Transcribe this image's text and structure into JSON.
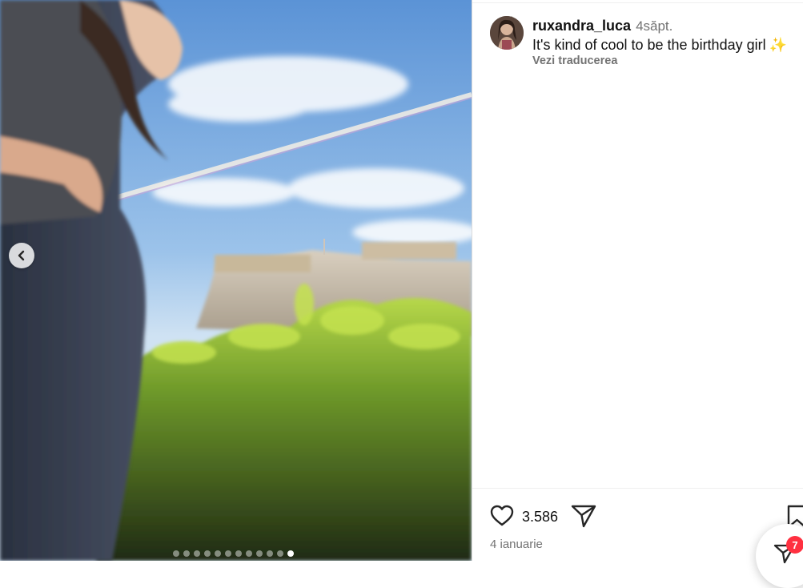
{
  "post": {
    "username": "ruxandra_luca",
    "time_ago": "4săpt.",
    "caption": "It's kind of cool to be the birthday girl",
    "caption_emoji": "✨",
    "translate_label": "Vezi traducerea",
    "likes": "3.586",
    "date": "4 ianuarie"
  },
  "carousel": {
    "slide_count": 12,
    "active_index": 11
  },
  "messages": {
    "badge": "7"
  },
  "icons": {
    "prev": "chevron-left-icon",
    "like": "heart-icon",
    "share": "paper-plane-icon",
    "save": "bookmark-icon",
    "messages": "messenger-icon"
  },
  "colors": {
    "secondary_text": "#737373",
    "badge": "#ff3040"
  }
}
